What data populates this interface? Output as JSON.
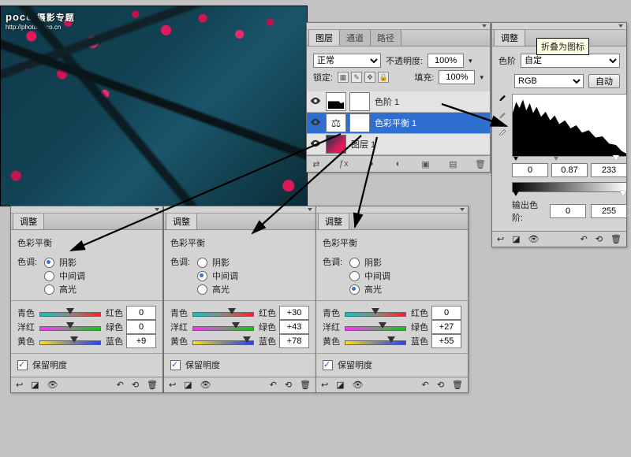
{
  "watermark": {
    "brand": "poco",
    "sub": "摄影专题",
    "url": "http://photo.poco.cn"
  },
  "layers": {
    "tabs": [
      "图层",
      "通道",
      "路径"
    ],
    "modeLabel": "正常",
    "opacityLabel": "不透明度:",
    "opacity": "100%",
    "lockLabel": "锁定:",
    "fillLabel": "填充:",
    "fill": "100%",
    "items": [
      {
        "name": "色阶 1",
        "kind": "hist"
      },
      {
        "name": "色彩平衡 1",
        "kind": "bal",
        "selected": true
      },
      {
        "name": "图层 1",
        "kind": "img"
      }
    ]
  },
  "levels": {
    "tab": "调整",
    "tooltip": "折叠为图标",
    "typeLabel": "色阶",
    "preset": "自定",
    "channel": "RGB",
    "autoBtn": "自动",
    "inBlack": "0",
    "inGamma": "0.87",
    "inWhite": "233",
    "outLabel": "输出色阶:",
    "outBlack": "0",
    "outWhite": "255"
  },
  "cb": {
    "tab": "调整",
    "title": "色彩平衡",
    "toneLabel": "色调:",
    "opts": {
      "shadows": "阴影",
      "mid": "中间调",
      "hi": "高光"
    },
    "pair1": {
      "l": "青色",
      "r": "红色"
    },
    "pair2": {
      "l": "洋红",
      "r": "绿色"
    },
    "pair3": {
      "l": "黄色",
      "r": "蓝色"
    },
    "preserve": "保留明度",
    "p1": {
      "sel": "shadows",
      "v1": "0",
      "v2": "0",
      "v3": "+9",
      "k1": 50,
      "k2": 50,
      "k3": 56
    },
    "p2": {
      "sel": "mid",
      "v1": "+30",
      "v2": "+43",
      "v3": "+78",
      "k1": 64,
      "k2": 70,
      "k3": 88
    },
    "p3": {
      "sel": "hi",
      "v1": "0",
      "v2": "+27",
      "v3": "+55",
      "k1": 50,
      "k2": 62,
      "k3": 76
    }
  }
}
